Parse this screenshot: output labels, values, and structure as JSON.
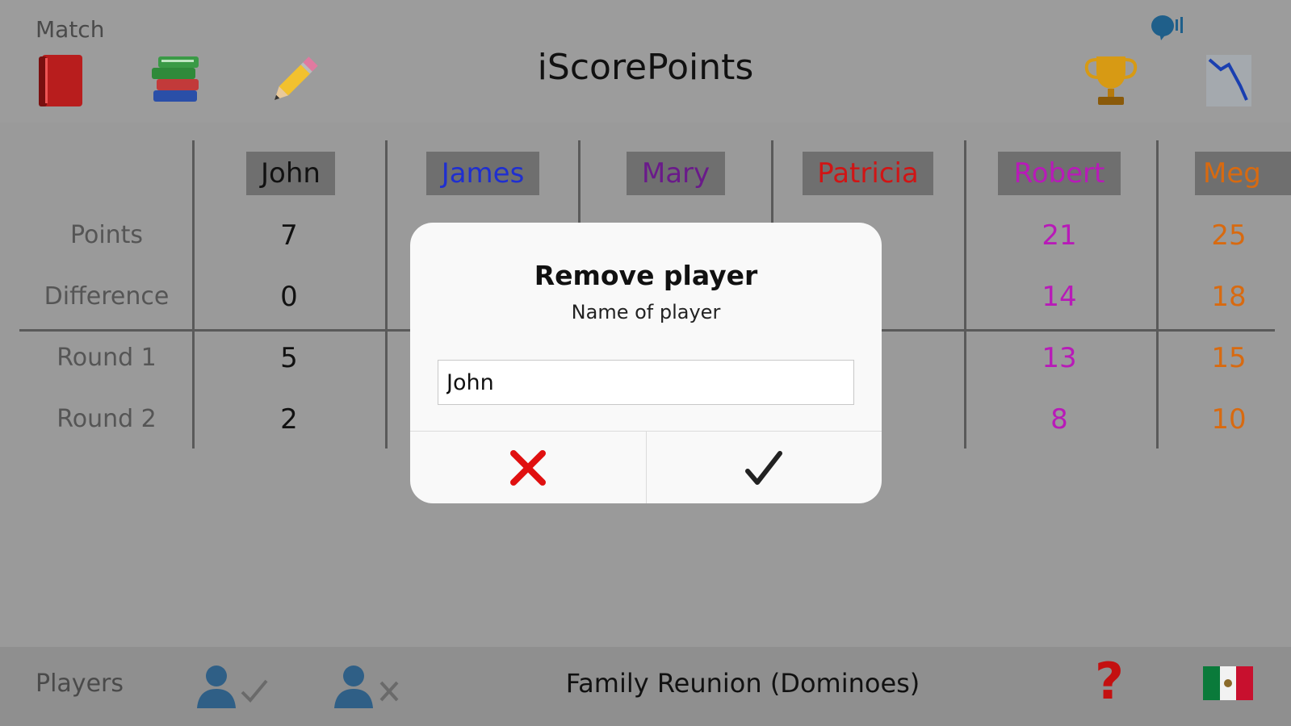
{
  "header": {
    "section_label": "Match",
    "title": "iScorePoints",
    "icons": [
      "book-icon",
      "books-icon",
      "pencil-icon",
      "trophy-icon",
      "chart-icon",
      "speaker-icon"
    ]
  },
  "table": {
    "row_labels": {
      "points": "Points",
      "difference": "Difference",
      "round1": "Round 1",
      "round2": "Round 2"
    },
    "players": [
      {
        "name": "John",
        "color": "#111111",
        "points": "7",
        "difference": "0",
        "round1": "5",
        "round2": "2"
      },
      {
        "name": "James",
        "color": "#1f2fd0",
        "points": "",
        "difference": "",
        "round1": "",
        "round2": ""
      },
      {
        "name": "Mary",
        "color": "#6a1a8a",
        "points": "",
        "difference": "",
        "round1": "",
        "round2": ""
      },
      {
        "name": "Patricia",
        "color": "#d01515",
        "points": "",
        "difference": "",
        "round1": "",
        "round2": ""
      },
      {
        "name": "Robert",
        "color": "#b81ab8",
        "points": "21",
        "difference": "14",
        "round1": "13",
        "round2": "8"
      },
      {
        "name": "Meg",
        "color": "#d86a10",
        "points": "25",
        "difference": "18",
        "round1": "15",
        "round2": "10"
      }
    ]
  },
  "footer": {
    "players_label": "Players",
    "match_name": "Family Reunion (Dominoes)",
    "help_symbol": "?"
  },
  "dialog": {
    "title": "Remove player",
    "message": "Name of player",
    "input_value": "John",
    "cancel_color": "#e01010",
    "confirm_color": "#222222"
  }
}
